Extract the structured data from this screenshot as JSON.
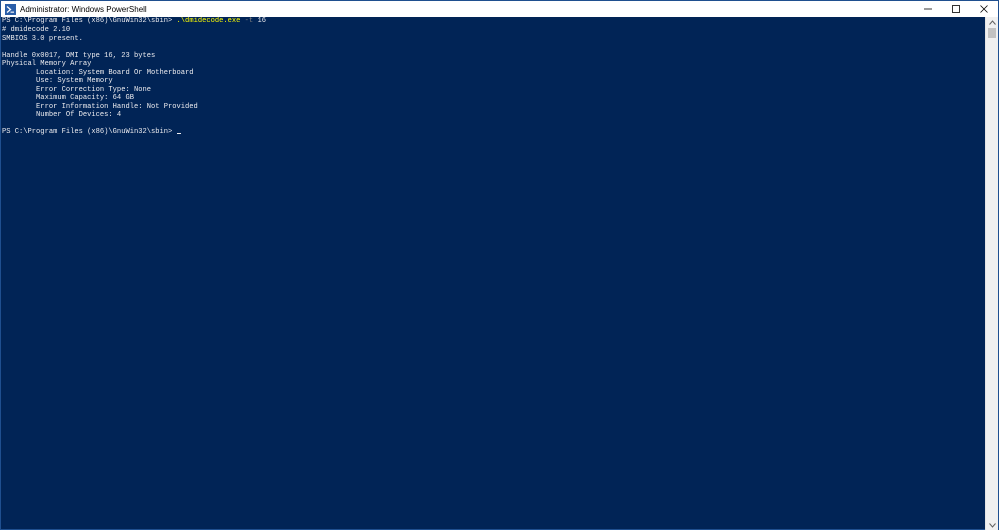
{
  "window": {
    "title": "Administrator: Windows PowerShell",
    "colors": {
      "console_background": "#012456",
      "console_text": "#eeedf0",
      "command_name": "#ffff00",
      "command_parameter": "#7f7f7f"
    }
  },
  "console": {
    "command_line": {
      "prompt": "PS C:\\Program Files (x86)\\GnuWin32\\sbin> ",
      "command": ".\\dmidecode.exe",
      "parameter": "-t",
      "argument": "16"
    },
    "output": [
      "# dmidecode 2.10",
      "SMBIOS 3.0 present.",
      "",
      "Handle 0x0017, DMI type 16, 23 bytes",
      "Physical Memory Array",
      "        Location: System Board Or Motherboard",
      "        Use: System Memory",
      "        Error Correction Type: None",
      "        Maximum Capacity: 64 GB",
      "        Error Information Handle: Not Provided",
      "        Number Of Devices: 4",
      ""
    ],
    "final_prompt": "PS C:\\Program Files (x86)\\GnuWin32\\sbin> "
  }
}
